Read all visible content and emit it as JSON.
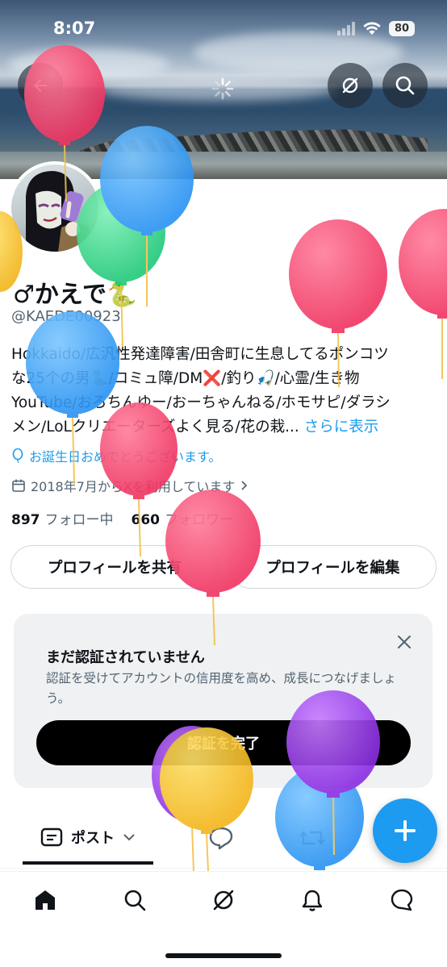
{
  "status_bar": {
    "time": "8:07",
    "battery": "80"
  },
  "profile": {
    "name": "♂かえで🐍",
    "handle": "@KAEDE00923",
    "bio_line1": "Hokkaido/広汎性発達障害/田舎町に生息してるポンコツ",
    "bio_line2": "な25个の男🐍/コミュ障/DM❌/釣り🎣/心霊/生き物",
    "bio_line3": "YouTube/おろちんゆー/おーちゃんねる/ホモサピ/ダラシ",
    "bio_line4": "メン/LoLクリエーターズよく見る/花の栽...",
    "more_label": "さらに表示",
    "birthday_text": "お誕生日おめでとうございます。",
    "joined_text": "2018年7月からXを利用しています",
    "following_count": "897",
    "following_label": "フォロー中",
    "followers_count": "660",
    "followers_label": "フォロワー"
  },
  "actions": {
    "share_label": "プロフィールを共有",
    "edit_label": "プロフィールを編集"
  },
  "verify_card": {
    "title": "まだ認証されていません",
    "description": "認証を受けてアカウントの信用度を高め、成長につなげましょう。",
    "button_label": "認証を完了"
  },
  "tabs": {
    "post_label": "ポスト"
  },
  "icons": [
    "back-arrow-icon",
    "grok-icon",
    "search-icon",
    "balloon-icon",
    "calendar-icon",
    "chevron-right-icon",
    "close-icon",
    "chevron-down-icon",
    "reply-icon",
    "retweet-icon",
    "plus-icon",
    "home-icon",
    "bell-icon",
    "messages-icon"
  ],
  "colors": {
    "accent": "#1d9bf0",
    "text": "#0f1419",
    "muted": "#536471",
    "card_bg": "#eff1f2"
  }
}
